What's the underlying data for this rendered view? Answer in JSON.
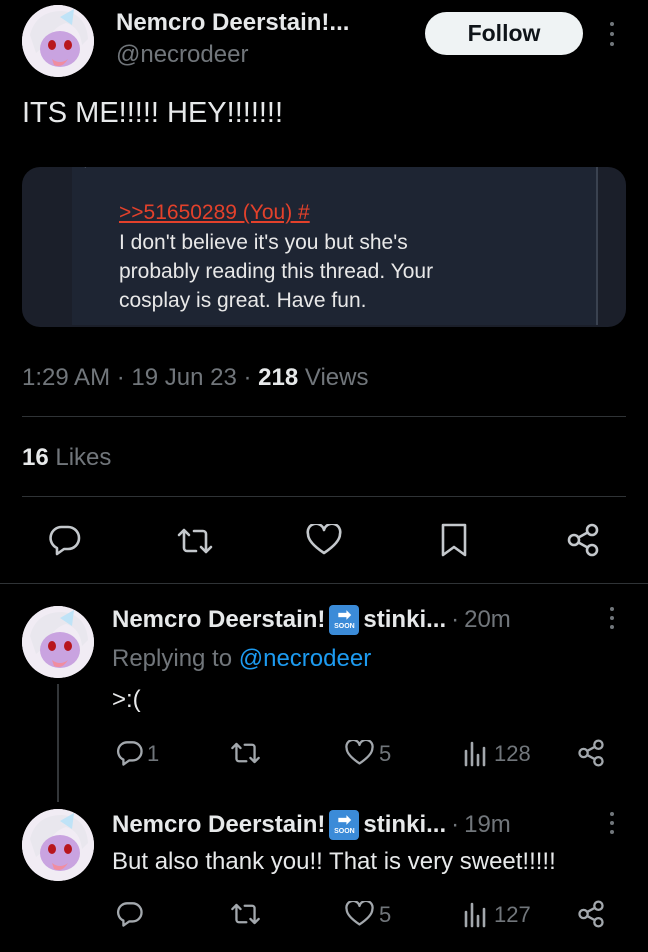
{
  "main_tweet": {
    "author_name": "Nemcro Deerstain!...",
    "author_handle": "@necrodeer",
    "follow_label": "Follow",
    "text": "ITS ME!!!!! HEY!!!!!!!",
    "quote": {
      "ref": ">>51650289 (You) #",
      "lines": [
        "I don't believe it's you but she's",
        "probably reading this thread. Your",
        "cosplay is great. Have fun."
      ]
    },
    "time": "1:29 AM",
    "date": "19 Jun 23",
    "views_count": "218",
    "views_label": "Views",
    "likes_count": "16",
    "likes_label": "Likes",
    "actions": [
      "reply-icon",
      "retweet-icon",
      "like-icon",
      "bookmark-icon",
      "share-icon"
    ]
  },
  "replies": [
    {
      "author_name": "Nemcro Deerstain!",
      "badge": {
        "arrow": "➡",
        "text": "SOON"
      },
      "author_suffix": "stinki...",
      "time": "20m",
      "replying_label": "Replying to",
      "replying_handle": "@necrodeer",
      "text": ">:(",
      "reply_count": "1",
      "retweet_count": "",
      "like_count": "5",
      "view_count": "128"
    },
    {
      "author_name": "Nemcro Deerstain!",
      "badge": {
        "arrow": "➡",
        "text": "SOON"
      },
      "author_suffix": "stinki...",
      "time": "19m",
      "text": "But also thank you!! That is very sweet!!!!!",
      "reply_count": "",
      "retweet_count": "",
      "like_count": "5",
      "view_count": "127"
    }
  ],
  "colors": {
    "background": "#000000",
    "text": "#e7e9ea",
    "muted": "#71767b",
    "link": "#1d9bf0",
    "quote_ref": "#e3412b"
  }
}
